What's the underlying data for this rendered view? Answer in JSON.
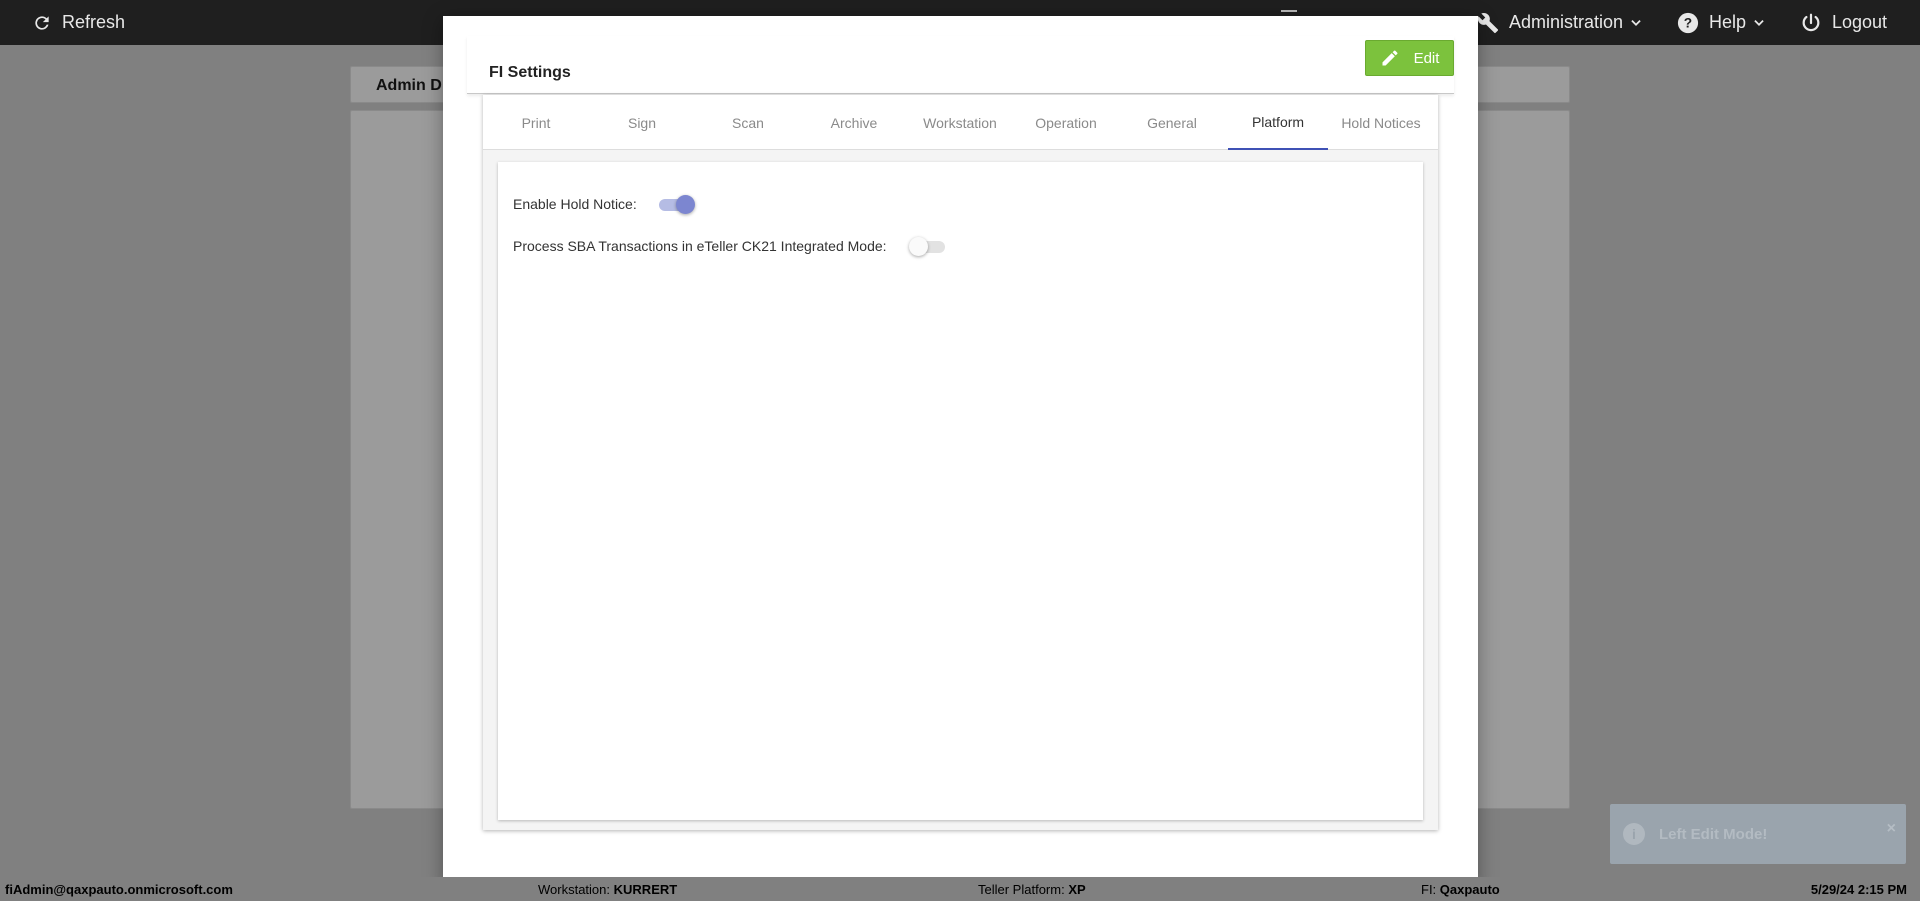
{
  "topbar": {
    "refresh_label": "Refresh",
    "administration_label": "Administration",
    "help_label": "Help",
    "logout_label": "Logout"
  },
  "background": {
    "header_title": "Admin D"
  },
  "modal": {
    "title": "FI Settings",
    "edit_label": "Edit",
    "tabs": [
      {
        "label": "Print"
      },
      {
        "label": "Sign"
      },
      {
        "label": "Scan"
      },
      {
        "label": "Archive"
      },
      {
        "label": "Workstation"
      },
      {
        "label": "Operation"
      },
      {
        "label": "General"
      },
      {
        "label": "Platform"
      },
      {
        "label": "Hold Notices"
      }
    ],
    "active_tab": "Platform",
    "settings": [
      {
        "label": "Enable Hold Notice:",
        "enabled": true
      },
      {
        "label": "Process SBA Transactions in eTeller CK21 Integrated Mode:",
        "enabled": false
      }
    ]
  },
  "toast": {
    "message": "Left Edit Mode!",
    "close": "×"
  },
  "footer": {
    "user": "fiAdmin@qaxpauto.onmicrosoft.com",
    "workstation_label": "Workstation:",
    "workstation_value": "KURRERT",
    "teller_platform_label": "Teller Platform:",
    "teller_platform_value": "XP",
    "fi_label": "FI:",
    "fi_value": "Qaxpauto",
    "datetime": "5/29/24 2:15 PM"
  },
  "colors": {
    "topbar": "#1f1f1f",
    "edit_button": "#7cc23d",
    "active_tab_underline": "#3f51b5",
    "toggle_on": "#7c86d0"
  }
}
